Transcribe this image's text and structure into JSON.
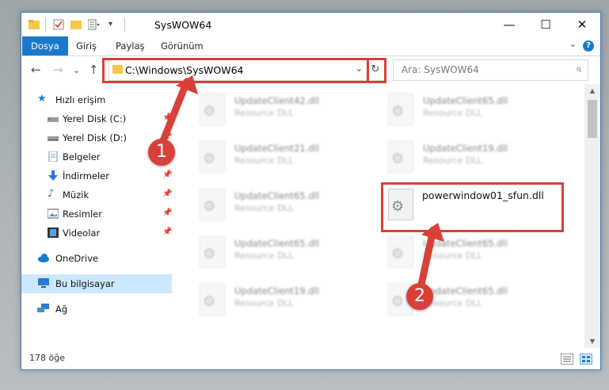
{
  "window": {
    "title": "SysWOW64",
    "controls": {
      "minimize": "—",
      "maximize": "☐",
      "close": "✕"
    }
  },
  "ribbon": {
    "tabs": [
      "Dosya",
      "Giriş",
      "Paylaş",
      "Görünüm"
    ],
    "active_tab": "Dosya",
    "help": "?",
    "collapse_glyph": "⌄"
  },
  "navigation": {
    "back": "←",
    "forward": "→",
    "recent": "⌄",
    "up": "↑",
    "address": "C:\\Windows\\SysWOW64",
    "address_dropdown": "⌄",
    "refresh": "↻",
    "search_placeholder": "Ara: SysWOW64",
    "search_icon": "⌕"
  },
  "sidebar": {
    "items": [
      {
        "label": "Hızlı erişim",
        "icon": "star-icon",
        "pinned": false
      },
      {
        "label": "Yerel Disk (C:)",
        "icon": "drive-icon",
        "pinned": true
      },
      {
        "label": "Yerel Disk (D:)",
        "icon": "drive-icon",
        "pinned": true
      },
      {
        "label": "Belgeler",
        "icon": "documents-icon",
        "pinned": true
      },
      {
        "label": "İndirmeler",
        "icon": "download-icon",
        "pinned": true
      },
      {
        "label": "Müzik",
        "icon": "music-icon",
        "pinned": true
      },
      {
        "label": "Resimler",
        "icon": "pictures-icon",
        "pinned": true
      },
      {
        "label": "Videolar",
        "icon": "videos-icon",
        "pinned": true
      },
      {
        "label": "OneDrive",
        "icon": "cloud-icon",
        "pinned": false
      },
      {
        "label": "Bu bilgisayar",
        "icon": "computer-icon",
        "pinned": false,
        "selected": true
      },
      {
        "label": "Ağ",
        "icon": "network-icon",
        "pinned": false
      }
    ],
    "pin_glyph": "📌"
  },
  "files": {
    "left_column": [
      {
        "name": "UpdateClient42.dll",
        "type": "Resource DLL"
      },
      {
        "name": "UpdateClient21.dll",
        "type": "Resource DLL"
      },
      {
        "name": "UpdateClient65.dll",
        "type": "Resource DLL"
      },
      {
        "name": "UpdateClient65.dll",
        "type": "Resource DLL"
      },
      {
        "name": "UpdateClient19.dll",
        "type": "Resource DLL"
      }
    ],
    "right_column": [
      {
        "name": "UpdateClient65.dll",
        "type": "Resource DLL"
      },
      {
        "name": "UpdateClient19.dll",
        "type": "Resource DLL"
      },
      {
        "name": "powerwindow01_sfun.dll",
        "type": "",
        "focused": true
      },
      {
        "name": "UpdateClient65.dll",
        "type": "Resource DLL"
      },
      {
        "name": "UpdateClient65.dll",
        "type": "Resource DLL"
      }
    ],
    "gear_glyph": "⚙"
  },
  "status": {
    "count": "178 öğe"
  },
  "annotations": {
    "step1": "1",
    "step2": "2",
    "color": "#d9403a"
  }
}
